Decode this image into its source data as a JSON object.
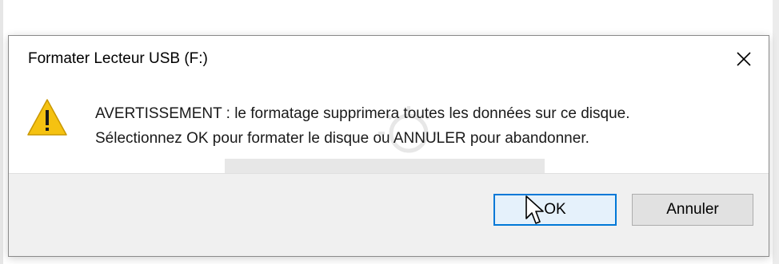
{
  "dialog": {
    "title": "Formater Lecteur USB (F:)",
    "close_icon": "close-icon",
    "warning_icon": "warning-triangle-icon",
    "message_lines": [
      "AVERTISSEMENT : le formatage supprimera toutes les données sur ce disque.",
      "Sélectionnez OK pour formater le disque ou ANNULER pour abandonner."
    ],
    "buttons": {
      "ok_label": "OK",
      "cancel_label": "Annuler"
    }
  },
  "colors": {
    "accent": "#0078d7",
    "warning": "#f5c211",
    "footer_bg": "#f0f0f0"
  }
}
